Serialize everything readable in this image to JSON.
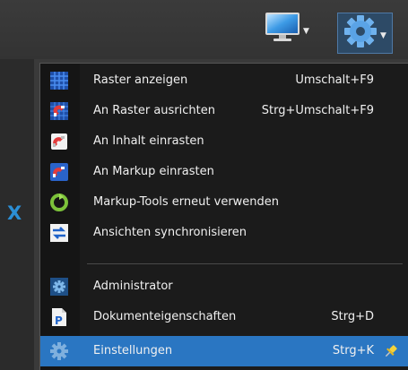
{
  "toolbar": {
    "monitor_icon": "monitor-icon",
    "gear_icon": "gear-icon"
  },
  "left_strip": {
    "close_glyph": "X"
  },
  "menu": {
    "items": [
      {
        "label": "Raster anzeigen",
        "shortcut": "Umschalt+F9",
        "icon": "grid-icon"
      },
      {
        "label": "An Raster ausrichten",
        "shortcut": "Strg+Umschalt+F9",
        "icon": "snap-to-grid-icon"
      },
      {
        "label": "An Inhalt einrasten",
        "shortcut": "",
        "icon": "snap-to-content-icon"
      },
      {
        "label": "An Markup einrasten",
        "shortcut": "",
        "icon": "snap-to-markup-icon"
      },
      {
        "label": "Markup-Tools erneut verwenden",
        "shortcut": "",
        "icon": "reuse-tools-icon"
      },
      {
        "label": "Ansichten synchronisieren",
        "shortcut": "",
        "icon": "sync-views-icon"
      },
      {
        "label": "Administrator",
        "shortcut": "",
        "icon": "admin-icon"
      },
      {
        "label": "Dokumenteigenschaften",
        "shortcut": "Strg+D",
        "icon": "document-properties-icon"
      },
      {
        "label": "Einstellungen",
        "shortcut": "Strg+K",
        "icon": "settings-icon",
        "highlighted": true
      }
    ]
  },
  "colors": {
    "highlight": "#2a76c2",
    "menu_bg": "#1b1b1b",
    "accent_blue": "#2b8fd6"
  }
}
